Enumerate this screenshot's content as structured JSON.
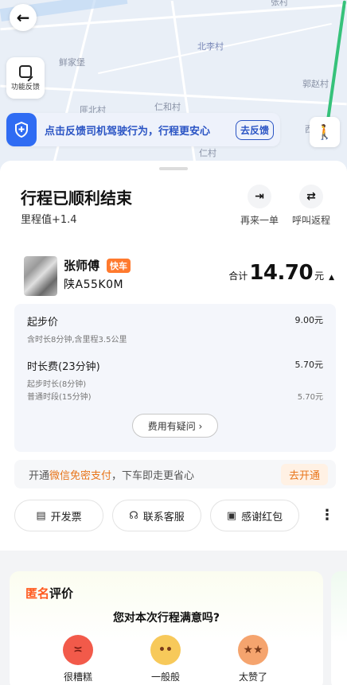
{
  "map": {
    "places": [
      "张村",
      "北李村",
      "鲜家堡",
      "郭赵村",
      "匪北村",
      "仁和村",
      "仁村",
      "西"
    ]
  },
  "feedback": {
    "label": "功能反馈"
  },
  "safety": {
    "text": "点击反馈司机驾驶行为，行程更安心",
    "action": "去反馈"
  },
  "trip": {
    "title": "行程已顺利结束",
    "points": "里程值+1.4",
    "actions": [
      {
        "label": "再来一单",
        "icon": "arrow-redo-icon"
      },
      {
        "label": "呼叫返程",
        "icon": "return-trip-icon"
      }
    ]
  },
  "driver": {
    "name": "张师傅",
    "badge": "快车",
    "plate": "陕A55K0M",
    "total_label": "合计",
    "total_amount": "14.70",
    "total_unit": "元"
  },
  "fees": {
    "base": {
      "label": "起步价",
      "amount": "9.00元",
      "note": "含时长8分钟,含里程3.5公里"
    },
    "duration": {
      "label": "时长费(23分钟)",
      "amount": "5.70元",
      "sub1": "起步时长(8分钟)",
      "sub2": "普通时段(15分钟)",
      "sub2_amount": "5.70元"
    },
    "question": "费用有疑问 ›"
  },
  "wechat": {
    "prefix": "开通",
    "highlight": "微信免密支付",
    "suffix": "，下车即走更省心",
    "action": "去开通"
  },
  "buttons": {
    "invoice": "开发票",
    "support": "联系客服",
    "tip": "感谢红包"
  },
  "rating": {
    "anon_part1": "匿名",
    "anon_part2": "评价",
    "question": "您对本次行程满意吗?",
    "options": [
      {
        "label": "很糟糕",
        "color": "#f25a4a"
      },
      {
        "label": "一般般",
        "color": "#f7c95a"
      },
      {
        "label": "太赞了",
        "color": "#f5a46e"
      }
    ]
  }
}
